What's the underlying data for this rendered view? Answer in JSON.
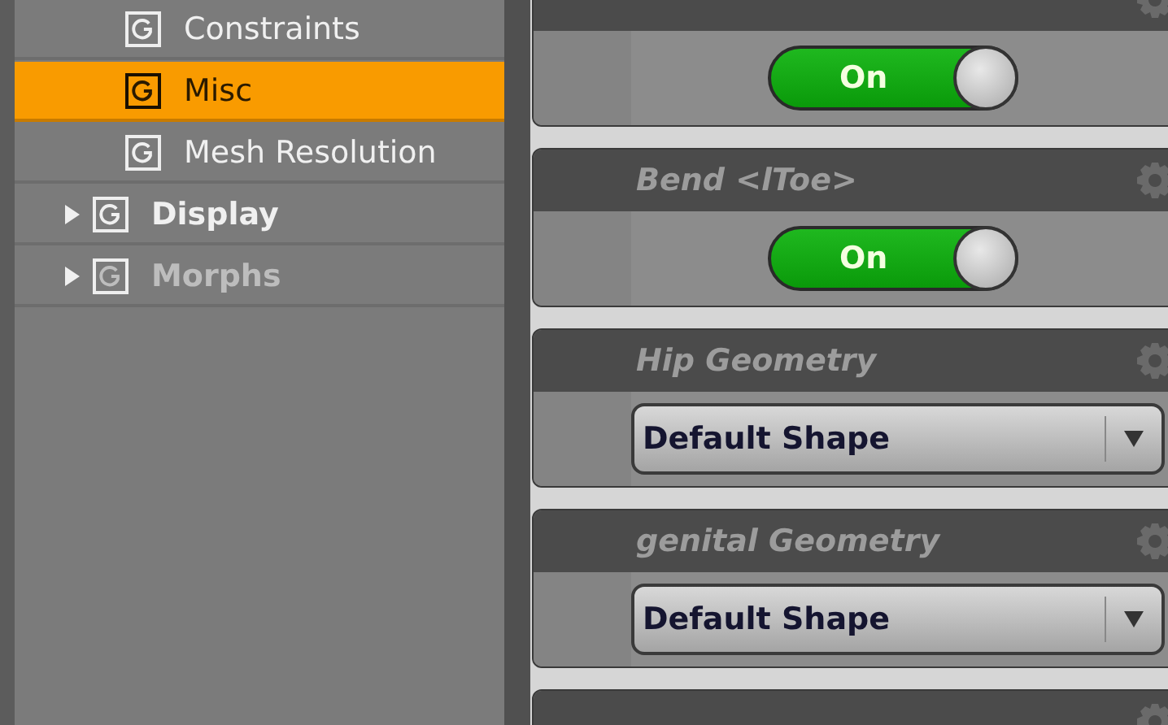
{
  "tree": [
    {
      "children": [
        {
          "label": "Constraints",
          "selected": false
        },
        {
          "label": "Misc",
          "selected": true
        },
        {
          "label": "Mesh Resolution",
          "selected": false
        }
      ]
    },
    {
      "label": "Display",
      "expanded": false,
      "disabled": false,
      "selected": false
    },
    {
      "label": "Morphs",
      "expanded": false,
      "disabled": true,
      "selected": false
    }
  ],
  "properties": [
    {
      "kind": "toggle",
      "on": true,
      "value": "On"
    },
    {
      "kind": "toggle",
      "label": "Bend <lToe>",
      "on": true,
      "value": "On"
    },
    {
      "kind": "dropdown",
      "label": "Hip Geometry",
      "value": "Default Shape"
    },
    {
      "kind": "dropdown",
      "label": "genital Geometry",
      "value": "Default Shape"
    },
    {
      "kind": "header"
    }
  ]
}
